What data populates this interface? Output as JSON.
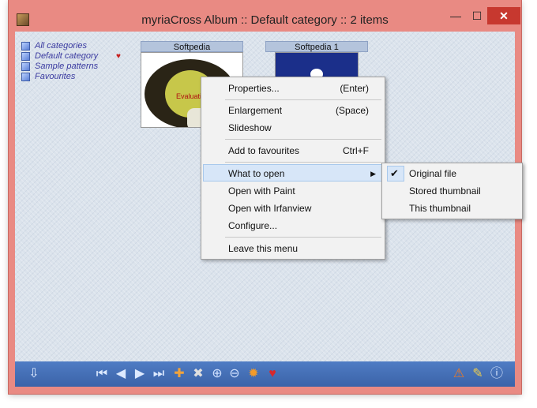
{
  "window": {
    "title": "myriaCross Album :: Default category :: 2 items",
    "minimize_glyph": "—",
    "maximize_glyph": "☐",
    "close_glyph": "✕"
  },
  "categories": [
    {
      "label": "All categories",
      "icon": "cube-icon"
    },
    {
      "label": "Default category",
      "icon": "cube-icon",
      "favourite_icon": "heart-icon"
    },
    {
      "label": "Sample patterns",
      "icon": "cube-icon"
    },
    {
      "label": "Favourites",
      "icon": "cube-icon"
    }
  ],
  "heart_glyph": "♥",
  "thumbnails": [
    {
      "label": "Softpedia",
      "image_text": "Evaluation"
    },
    {
      "label": "Softpedia 1"
    }
  ],
  "context_menu": {
    "items": [
      {
        "label": "Properties...",
        "shortcut": "(Enter)"
      },
      {
        "label": "Enlargement",
        "shortcut": "(Space)"
      },
      {
        "label": "Slideshow",
        "shortcut": ""
      },
      {
        "label": "Add to favourites",
        "shortcut": "Ctrl+F"
      },
      {
        "label": "What to open",
        "shortcut": "",
        "submenu_glyph": "▶"
      },
      {
        "label": "Open with Paint",
        "shortcut": ""
      },
      {
        "label": "Open with Irfanview",
        "shortcut": ""
      },
      {
        "label": "Configure...",
        "shortcut": ""
      },
      {
        "label": "Leave this menu",
        "shortcut": ""
      }
    ]
  },
  "submenu": {
    "items": [
      {
        "label": "Original file",
        "checked": true
      },
      {
        "label": "Stored thumbnail",
        "checked": false
      },
      {
        "label": "This thumbnail",
        "checked": false
      }
    ],
    "check_glyph": "✔"
  },
  "toolbar": {
    "icons": [
      {
        "name": "down-arrow-icon",
        "glyph": "⇩"
      },
      {
        "name": "first-icon",
        "glyph": "⏮"
      },
      {
        "name": "previous-icon",
        "glyph": "◀"
      },
      {
        "name": "next-icon",
        "glyph": "▶"
      },
      {
        "name": "last-icon",
        "glyph": "⏭"
      },
      {
        "name": "add-image-icon",
        "glyph": "✚"
      },
      {
        "name": "remove-image-icon",
        "glyph": "✖"
      },
      {
        "name": "zoom-in-icon",
        "glyph": "⊕"
      },
      {
        "name": "zoom-out-icon",
        "glyph": "⊖"
      },
      {
        "name": "settings-icon",
        "glyph": "✹"
      },
      {
        "name": "favourite-icon",
        "glyph": "♥"
      },
      {
        "name": "warning-icon",
        "glyph": "⚠"
      },
      {
        "name": "brush-icon",
        "glyph": "✎"
      },
      {
        "name": "info-icon",
        "glyph": "ⓘ"
      }
    ]
  },
  "colors": {
    "frame": "#e98a83",
    "toolbar": "#4670b8",
    "heart": "#c72020",
    "menu_highlight": "#d7e6f8"
  }
}
